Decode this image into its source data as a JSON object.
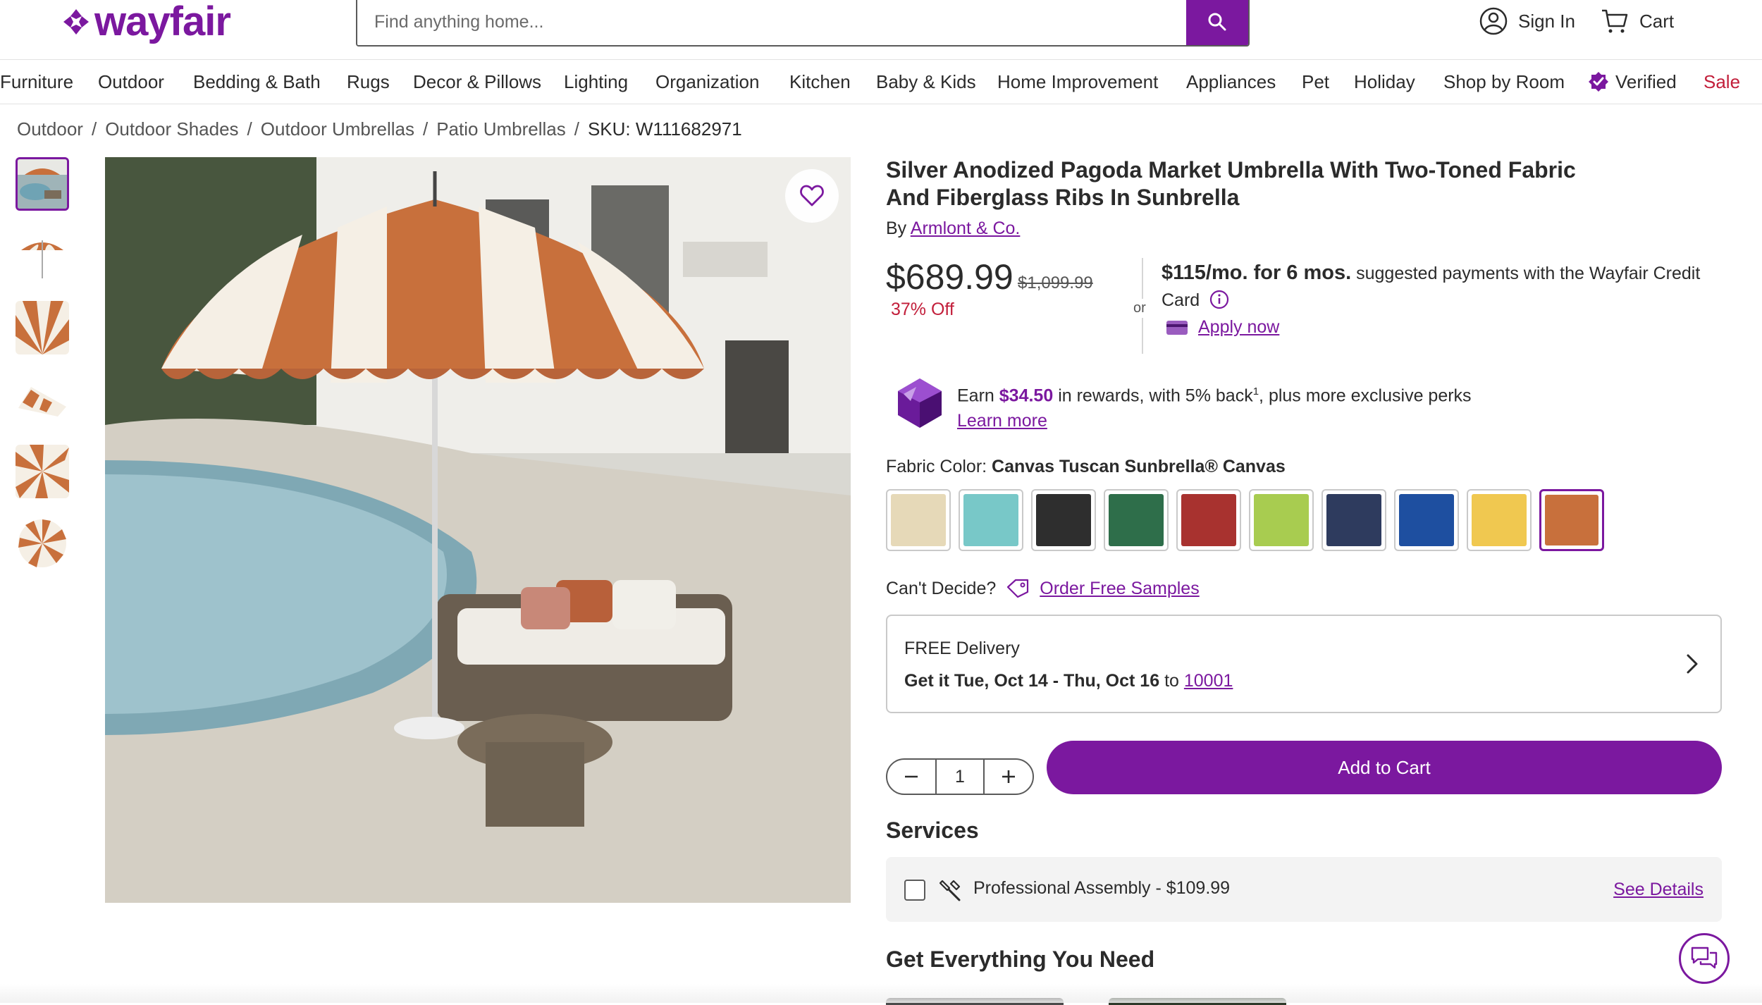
{
  "header": {
    "logo_text": "wayfair",
    "search_placeholder": "Find anything home...",
    "sign_in": "Sign In",
    "cart": "Cart"
  },
  "nav": {
    "items": [
      "Furniture",
      "Outdoor",
      "Bedding & Bath",
      "Rugs",
      "Decor & Pillows",
      "Lighting",
      "Organization",
      "Kitchen",
      "Baby & Kids",
      "Home Improvement",
      "Appliances",
      "Pet",
      "Holiday",
      "Shop by Room",
      "Verified",
      "Sale"
    ]
  },
  "breadcrumb": [
    "Outdoor",
    "Outdoor Shades",
    "Outdoor Umbrellas",
    "Patio Umbrellas",
    "SKU: W111682971"
  ],
  "product": {
    "title": "Silver Anodized Pagoda Market Umbrella With Two-Toned Fabric And Fiberglass Ribs In Sunbrella",
    "by_prefix": "By",
    "brand": "Armlont & Co.",
    "price": "$689.99",
    "was_price": "$1,099.99",
    "discount": "37% Off",
    "or": "or",
    "monthly": "$115/mo. for 6 mos.",
    "monthly_suffix": "suggested payments with the Wayfair Credit Card",
    "apply_now": "Apply now",
    "rewards_earn": "Earn",
    "rewards_amount": "$34.50",
    "rewards_text": "in rewards, with 5% back",
    "rewards_sup": "1",
    "rewards_tail": ", plus more exclusive perks",
    "learn_more": "Learn more",
    "color_label": "Fabric Color:",
    "color_value": "Canvas Tuscan Sunbrella® Canvas",
    "swatches": [
      "#e6d9b8",
      "#78c8c8",
      "#2e2e2e",
      "#2e6e4a",
      "#a8322f",
      "#a8cc50",
      "#2e3b5e",
      "#1e4fa0",
      "#f0c850",
      "#c8703c"
    ],
    "selected_swatch": 9,
    "cant_decide": "Can't Decide?",
    "order_samples": "Order Free Samples",
    "delivery_line1": "FREE Delivery",
    "delivery_line2": "Get it Tue, Oct 14 - Thu, Oct 16",
    "delivery_to": "to",
    "zip": "10001",
    "quantity": "1",
    "add_to_cart": "Add to Cart",
    "services_title": "Services",
    "service_label": "Professional Assembly - $109.99",
    "see_details": "See Details",
    "everything_title": "Get Everything You Need"
  },
  "colors": {
    "brand": "#7b189f",
    "sale": "#c21e3a"
  },
  "icons": [
    "search-icon",
    "account-icon",
    "cart-icon",
    "verified-icon",
    "heart-icon",
    "info-icon",
    "credit-card-icon",
    "rewards-gem-icon",
    "tag-icon",
    "chevron-right-icon",
    "minus-icon",
    "plus-icon",
    "tools-icon",
    "chat-icon"
  ]
}
